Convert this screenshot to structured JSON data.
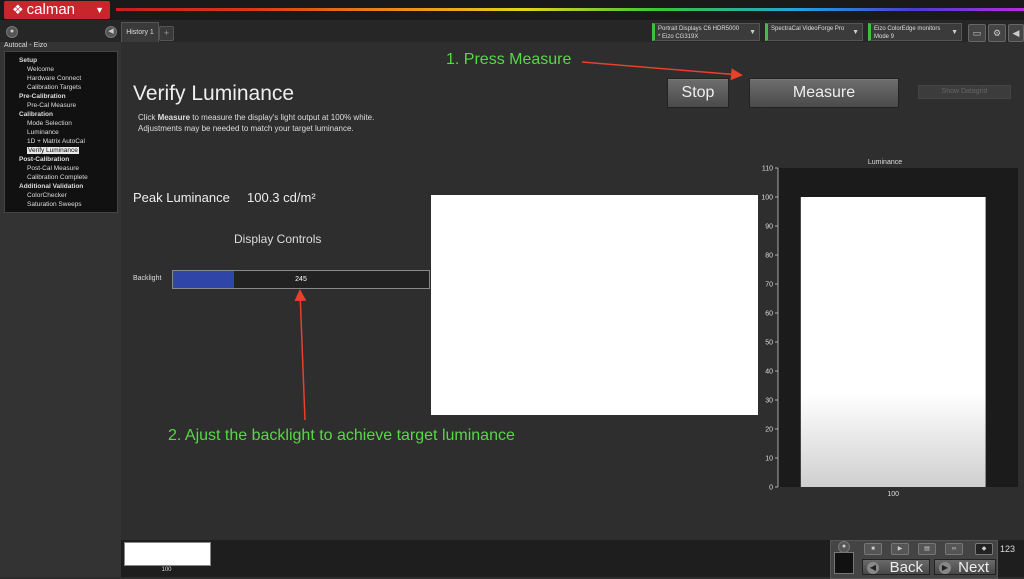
{
  "app": {
    "brand": "calman"
  },
  "tabs": {
    "history_label": "History 1",
    "add_label": "+"
  },
  "devices": [
    {
      "line1": "Portrait Displays C6 HDR5000",
      "line2": "* Eizo CG319X"
    },
    {
      "line1": "SpectraCal VideoForge Pro",
      "line2": ""
    },
    {
      "line1": "Eizo ColorEdge monitors",
      "line2": "Mode 9"
    }
  ],
  "sidebar": {
    "title": "Autocal - Eizo",
    "sections": [
      {
        "label": "Setup",
        "items": [
          "Welcome",
          "Hardware Connect",
          "Calibration Targets"
        ]
      },
      {
        "label": "Pre-Calibration",
        "items": [
          "Pre-Cal Measure"
        ]
      },
      {
        "label": "Calibration",
        "items": [
          "Mode Selection",
          "Luminance",
          "1D + Matrix AutoCal",
          "Verify Luminance"
        ]
      },
      {
        "label": "Post-Calibration",
        "items": [
          "Post-Cal Measure",
          "Calibration Complete"
        ]
      },
      {
        "label": "Additional Validation",
        "items": [
          "ColorChecker",
          "Saturation Sweeps"
        ]
      }
    ],
    "active_item": "Verify Luminance"
  },
  "main": {
    "heading": "Verify Luminance",
    "desc_prefix": "Click ",
    "desc_bold": "Measure",
    "desc_rest": " to measure the display's light output at 100% white.",
    "desc_line2": "Adjustments may be needed to match your target luminance.",
    "stop_label": "Stop",
    "measure_label": "Measure",
    "show_datagrid_label": "Show Datagrid",
    "peak_label": "Peak Luminance",
    "peak_value": "100.3 cd/m²",
    "display_controls_label": "Display Controls",
    "backlight_label": "Backlight",
    "backlight_value": "245",
    "backlight_fraction": 0.24
  },
  "annotations": {
    "step1": "1. Press Measure",
    "step2": "2. Ajust the backlight to achieve target luminance",
    "color": "#55d944",
    "arrow_color": "#e8402a"
  },
  "chart_data": {
    "type": "bar",
    "title": "Luminance",
    "categories": [
      "100"
    ],
    "values": [
      100
    ],
    "ylim": [
      0,
      110
    ],
    "yticks": [
      0,
      10,
      20,
      30,
      40,
      50,
      60,
      70,
      80,
      90,
      100,
      110
    ]
  },
  "bottom": {
    "thumb_label": "100",
    "back_label": "Back",
    "next_label": "Next",
    "counter": "123"
  }
}
